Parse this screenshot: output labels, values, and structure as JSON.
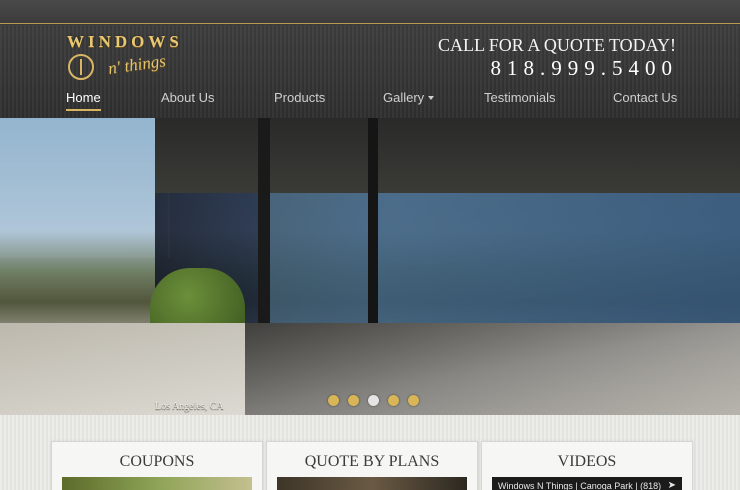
{
  "logo": {
    "word": "WINDOWS",
    "script": "n' things"
  },
  "cta": {
    "title": "CALL FOR A QUOTE TODAY!",
    "phone": "818.999.5400"
  },
  "nav": {
    "items": [
      {
        "label": "Home",
        "active": true
      },
      {
        "label": "About Us"
      },
      {
        "label": "Products"
      },
      {
        "label": "Gallery",
        "dropdown": true
      },
      {
        "label": "Testimonials"
      },
      {
        "label": "Contact Us"
      }
    ]
  },
  "hero": {
    "caption": "Los Angeles, CA",
    "slides": 5,
    "active_slide": 3
  },
  "cards": [
    {
      "title": "COUPONS"
    },
    {
      "title": "QUOTE BY PLANS"
    },
    {
      "title": "VIDEOS",
      "video_title": "Windows N Things | Canoga Park | (818)"
    }
  ],
  "colors": {
    "accent": "#d7b561",
    "header_bg": "#333333"
  }
}
